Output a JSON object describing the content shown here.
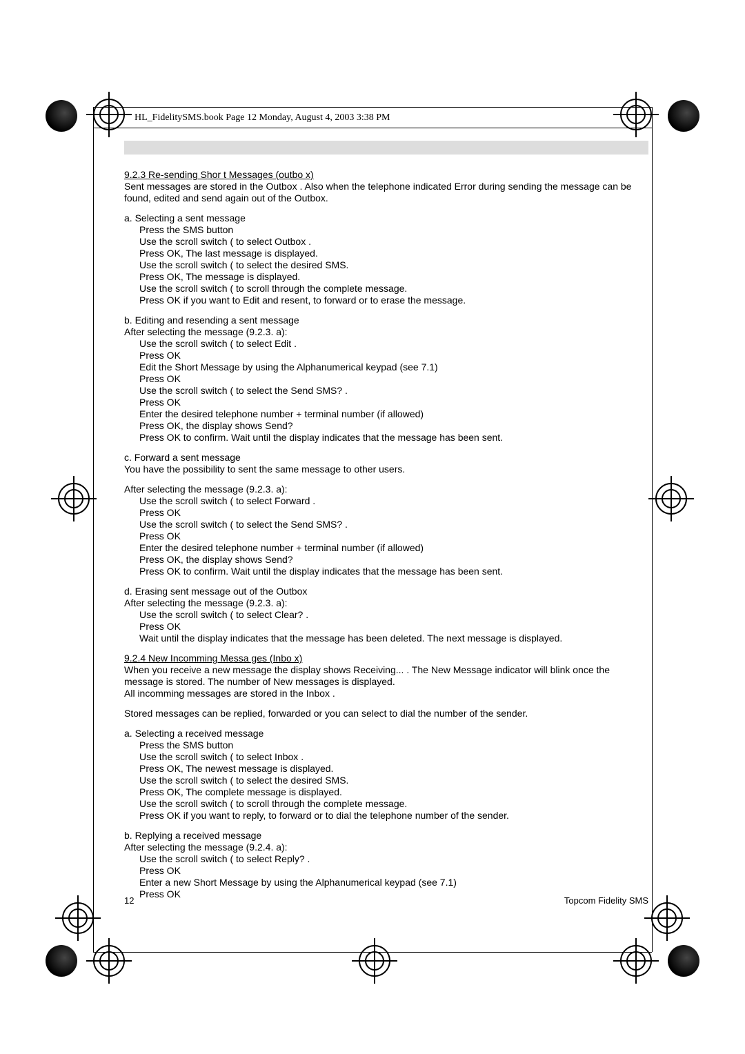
{
  "header": {
    "pagetag": "HL_FidelitySMS.book  Page 12  Monday, August 4, 2003  3:38 PM"
  },
  "s923": {
    "title": "9.2.3 Re-sending Shor t Messages (outbo x)",
    "intro": "Sent messages are stored in the  Outbox . Also when the telephone indicated  Error  during sending the message can be found, edited and send again out of the Outbox.",
    "a_title": "a. Selecting a sent message",
    "a1": "Press the SMS button",
    "a2": "Use the scroll switch  (  to select  Outbox .",
    "a3": "Press OK, The last message is displayed.",
    "a4": "Use the scroll switch  (  to select the desired SMS.",
    "a5": "Press OK, The message is displayed.",
    "a6": "Use the scroll switch  (  to scroll through the complete message.",
    "a7": "Press OK if you want to Edit and resent, to forward or to erase the message.",
    "b_title": "b. Editing and resending a sent message",
    "b_after": "After selecting the message (9.2.3. a):",
    "b1": "Use the scroll switch  (  to select  Edit .",
    "b2": "Press OK",
    "b3": "Edit the Short Message by using the Alphanumerical keypad (see 7.1)",
    "b4": "Press OK",
    "b5": "Use the scroll switch  (  to select the  Send SMS? .",
    "b6": "Press OK",
    "b7": "Enter the desired telephone number + terminal number (if allowed)",
    "b8": "Press OK, the display shows   Send? ",
    "b9": "Press OK to confirm. Wait until the display indicates that the message has been sent.",
    "c_title": "c. Forward a sent message",
    "c_after": "You have the possibility to sent the same message to other users.",
    "c_after2": "After selecting the message (9.2.3. a):",
    "c1": "Use the scroll switch  (  to select  Forward .",
    "c2": "Press OK",
    "c3": "Use the scroll switch  (  to select the  Send SMS? .",
    "c4": "Press OK",
    "c5": "Enter the desired telephone number + terminal number (if allowed)",
    "c6": "Press OK, the display shows   Send? ",
    "c7": "Press OK to confirm. Wait until the display indicates that the message has been sent.",
    "d_title": "d. Erasing sent message out of the Outbox",
    "d_after": "After selecting the message (9.2.3. a):",
    "d1": "Use the scroll switch  (  to select  Clear? .",
    "d2": "Press OK",
    "d3": "Wait until the display indicates that the message has been deleted. The next message is displayed."
  },
  "s924": {
    "title": "9.2.4 New Incomming Messa  ges (Inbo x)",
    "intro1": "When you receive a new message the display shows  Receiving... . The New Message indicator will blink once the message is stored. The number of New messages is displayed.",
    "intro2": "All incomming messages are stored in the  Inbox .",
    "intro3": "Stored messages can be replied, forwarded or you can select to dial the number of the sender.",
    "a_title": "a. Selecting a received message",
    "a1": "Press the SMS button",
    "a2": "Use the scroll switch  (  to select  Inbox .",
    "a3": "Press OK, The newest message is displayed.",
    "a4": "Use the scroll switch  (  to select the desired SMS.",
    "a5": "Press OK, The complete message is displayed.",
    "a6": "Use the scroll switch  (  to scroll through the complete message.",
    "a7": "Press OK if you want to reply, to forward or to dial the telephone number of the sender.",
    "b_title": "b. Replying a received message",
    "b_after": "After selecting the message (9.2.4. a):",
    "b1": "Use the scroll switch  (  to select  Reply? .",
    "b2": "Press OK",
    "b3": "Enter a new Short Message by using the Alphanumerical keypad (see 7.1)",
    "b4": "Press OK"
  },
  "footer": {
    "pagenum": "12",
    "brand": "Topcom Fidelity SMS"
  }
}
